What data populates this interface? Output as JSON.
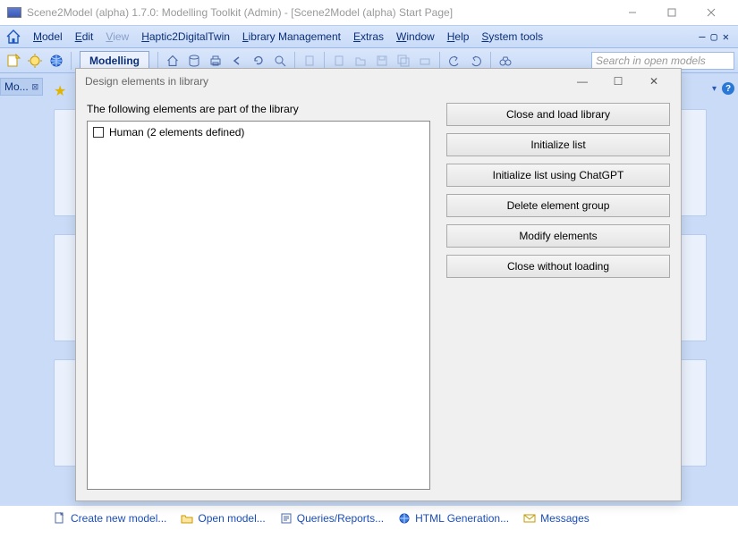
{
  "window": {
    "title": "Scene2Model (alpha) 1.7.0: Modelling Toolkit (Admin) - [Scene2Model (alpha) Start Page]"
  },
  "menu": {
    "items": [
      "Model",
      "Edit",
      "View",
      "Haptic2DigitalTwin",
      "Library Management",
      "Extras",
      "Window",
      "Help",
      "System tools"
    ],
    "disabled_index": 2
  },
  "toolbar": {
    "mode_label": "Modelling",
    "search_placeholder": "Search in open models"
  },
  "sidebar": {
    "tab_label": "Mo..."
  },
  "dialog": {
    "title": "Design elements in library",
    "caption": "The following elements are part of the library",
    "items": [
      {
        "label": "Human (2 elements defined)",
        "checked": false
      }
    ],
    "buttons": [
      "Close and load library",
      "Initialize list",
      "Initialize list using ChatGPT",
      "Delete element group",
      "Modify elements",
      "Close without loading"
    ]
  },
  "links": {
    "create": "Create new model...",
    "open": "Open model...",
    "queries": "Queries/Reports...",
    "html": "HTML Generation...",
    "messages": "Messages"
  }
}
